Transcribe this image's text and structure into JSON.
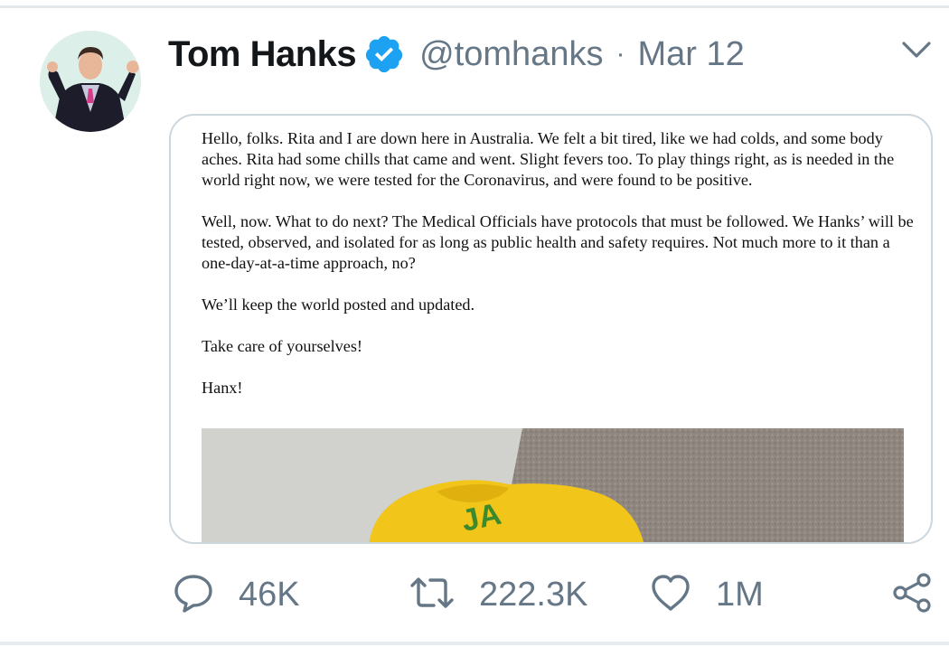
{
  "tweet": {
    "display_name": "Tom Hanks",
    "handle": "@tomhanks",
    "separator": "·",
    "date": "Mar 12",
    "verified_icon": "verified-badge-icon",
    "menu_icon": "chevron-down-icon"
  },
  "letter": {
    "paragraphs": [
      "Hello, folks. Rita and I are down here in Australia. We felt a bit tired, like we had colds, and some body aches. Rita had some chills that came and went. Slight fevers too. To play things right, as is needed in the world right now, we were tested for the Coronavirus, and were found to be positive.",
      "Well, now. What to do next? The Medical Officials have protocols that must be followed. We Hanks’ will be tested, observed, and isolated for as long as public health and safety requires.  Not much more to it than a one-day-at-a-time approach, no?",
      "We’ll keep the world posted and updated.",
      "Take care of yourselves!",
      "Hanx!"
    ],
    "photo_label": "JA"
  },
  "actions": {
    "reply_count": "46K",
    "retweet_count": "222.3K",
    "like_count": "1M",
    "icons": [
      "reply-icon",
      "retweet-icon",
      "like-icon",
      "share-icon"
    ]
  },
  "colors": {
    "verified_blue": "#1da1f2",
    "secondary_text": "#657786",
    "primary_text": "#14171a",
    "card_border": "#ccd6dd"
  }
}
